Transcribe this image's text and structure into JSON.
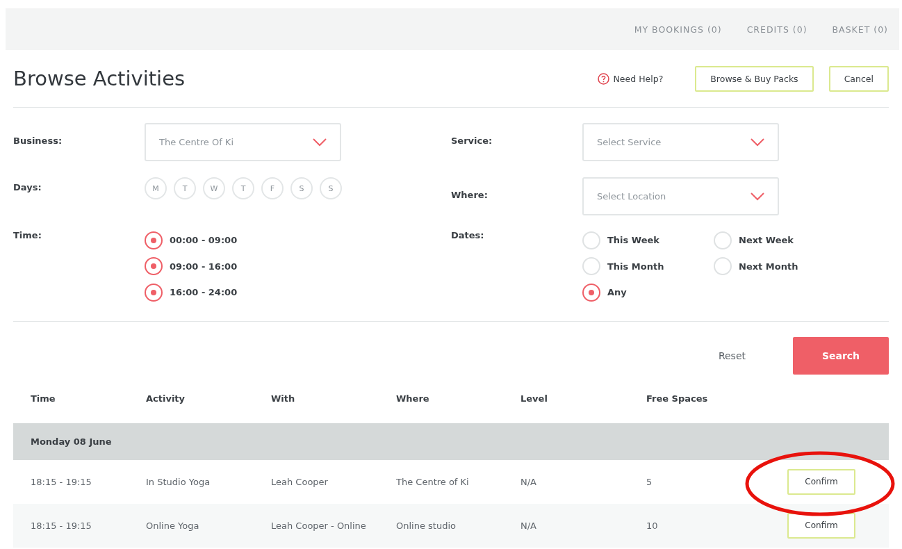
{
  "top_nav": [
    "MY BOOKINGS (0)",
    "CREDITS (0)",
    "BASKET (0)"
  ],
  "title": "Browse Activities",
  "help": "Need Help?",
  "header_buttons": [
    "Browse & Buy Packs",
    "Cancel"
  ],
  "filters": {
    "business": {
      "label": "Business:",
      "value": "The Centre Of Ki"
    },
    "service": {
      "label": "Service:",
      "placeholder": "Select Service"
    },
    "where": {
      "label": "Where:",
      "placeholder": "Select Location"
    },
    "days": {
      "label": "Days:",
      "items": [
        {
          "label": "M",
          "selected": false
        },
        {
          "label": "T",
          "selected": false
        },
        {
          "label": "W",
          "selected": false
        },
        {
          "label": "T",
          "selected": false
        },
        {
          "label": "F",
          "selected": false
        },
        {
          "label": "S",
          "selected": false
        },
        {
          "label": "S",
          "selected": false
        }
      ]
    },
    "time": {
      "label": "Time:",
      "options": [
        {
          "label": "00:00 - 09:00",
          "selected": true
        },
        {
          "label": "09:00 - 16:00",
          "selected": true
        },
        {
          "label": "16:00 - 24:00",
          "selected": true
        }
      ]
    },
    "dates": {
      "label": "Dates:",
      "options": [
        {
          "label": "This Week",
          "selected": false
        },
        {
          "label": "Next Week",
          "selected": false
        },
        {
          "label": "This Month",
          "selected": false
        },
        {
          "label": "Next Month",
          "selected": false
        },
        {
          "label": "Any",
          "selected": true
        }
      ]
    }
  },
  "actions": {
    "reset": "Reset",
    "search": "Search"
  },
  "table": {
    "columns": [
      "Time",
      "Activity",
      "With",
      "Where",
      "Level",
      "Free Spaces"
    ],
    "groups": [
      {
        "heading": "Monday 08 June",
        "rows": [
          {
            "cells": [
              "18:15 - 19:15",
              "In Studio Yoga",
              "Leah Cooper",
              "The Centre of Ki",
              "N/A",
              "5"
            ],
            "action": "Confirm"
          },
          {
            "cells": [
              "18:15 - 19:15",
              "Online Yoga",
              "Leah Cooper - Online",
              "Online studio",
              "N/A",
              "10"
            ],
            "action": "Confirm"
          }
        ]
      }
    ]
  }
}
